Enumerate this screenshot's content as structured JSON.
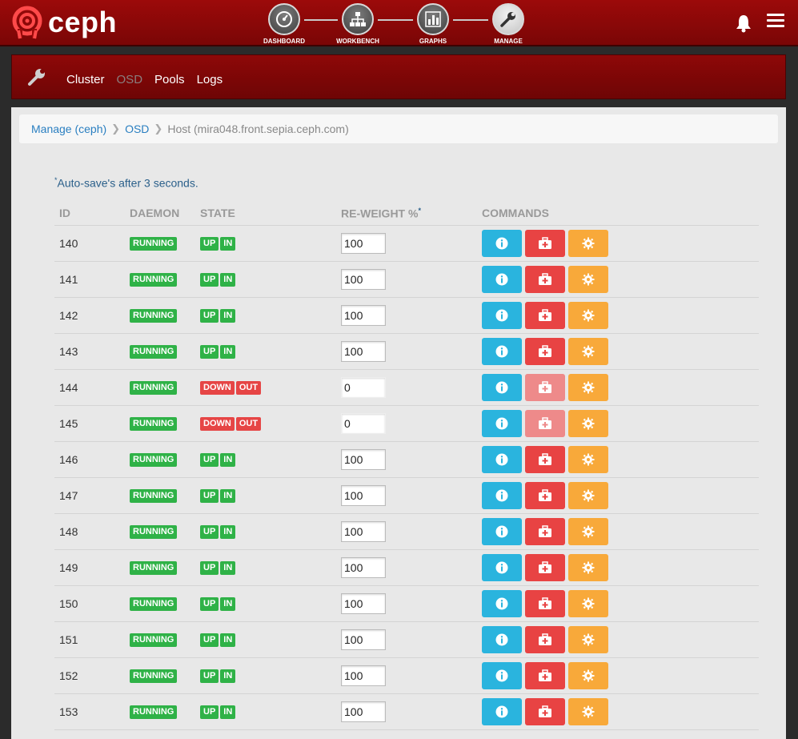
{
  "app": {
    "logo_text": "ceph",
    "brand_color": "#8e0808"
  },
  "hub": [
    {
      "label": "DASHBOARD",
      "icon": "gauge-icon"
    },
    {
      "label": "WORKBENCH",
      "icon": "hierarchy-icon"
    },
    {
      "label": "GRAPHS",
      "icon": "bar-chart-icon"
    },
    {
      "label": "MANAGE",
      "icon": "wrench-icon",
      "active": true
    }
  ],
  "subnav": [
    {
      "label": "Cluster"
    },
    {
      "label": "OSD",
      "active": true
    },
    {
      "label": "Pools"
    },
    {
      "label": "Logs"
    }
  ],
  "breadcrumb": {
    "manage": "Manage (ceph)",
    "osd": "OSD",
    "host": "Host (mira048.front.sepia.ceph.com)"
  },
  "note": {
    "star": "*",
    "text": "Auto-save's after 3 seconds."
  },
  "table": {
    "headers": {
      "id": "ID",
      "daemon": "DAEMON",
      "state": "STATE",
      "reweight": "RE-WEIGHT %",
      "reweight_star": "*",
      "commands": "COMMANDS"
    },
    "rows": [
      {
        "id": "140",
        "daemon": "RUNNING",
        "state1": "UP",
        "state2": "IN",
        "reweight": "100"
      },
      {
        "id": "141",
        "daemon": "RUNNING",
        "state1": "UP",
        "state2": "IN",
        "reweight": "100"
      },
      {
        "id": "142",
        "daemon": "RUNNING",
        "state1": "UP",
        "state2": "IN",
        "reweight": "100"
      },
      {
        "id": "143",
        "daemon": "RUNNING",
        "state1": "UP",
        "state2": "IN",
        "reweight": "100"
      },
      {
        "id": "144",
        "daemon": "RUNNING",
        "state1": "DOWN",
        "state2": "OUT",
        "reweight": "0"
      },
      {
        "id": "145",
        "daemon": "RUNNING",
        "state1": "DOWN",
        "state2": "OUT",
        "reweight": "0"
      },
      {
        "id": "146",
        "daemon": "RUNNING",
        "state1": "UP",
        "state2": "IN",
        "reweight": "100"
      },
      {
        "id": "147",
        "daemon": "RUNNING",
        "state1": "UP",
        "state2": "IN",
        "reweight": "100"
      },
      {
        "id": "148",
        "daemon": "RUNNING",
        "state1": "UP",
        "state2": "IN",
        "reweight": "100"
      },
      {
        "id": "149",
        "daemon": "RUNNING",
        "state1": "UP",
        "state2": "IN",
        "reweight": "100"
      },
      {
        "id": "150",
        "daemon": "RUNNING",
        "state1": "UP",
        "state2": "IN",
        "reweight": "100"
      },
      {
        "id": "151",
        "daemon": "RUNNING",
        "state1": "UP",
        "state2": "IN",
        "reweight": "100"
      },
      {
        "id": "152",
        "daemon": "RUNNING",
        "state1": "UP",
        "state2": "IN",
        "reweight": "100"
      },
      {
        "id": "153",
        "daemon": "RUNNING",
        "state1": "UP",
        "state2": "IN",
        "reweight": "100"
      }
    ]
  },
  "colors": {
    "running": "#2fb247",
    "down": "#e64545",
    "info": "#2ab4de",
    "repair": "#e84343",
    "config": "#f8a93a"
  }
}
